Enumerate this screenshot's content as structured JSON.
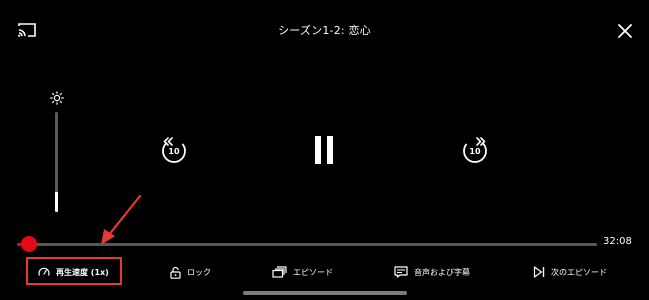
{
  "player": {
    "title": "シーズン1-2: 恋心",
    "current_time": "32:08",
    "progress_fraction": 0.02,
    "brightness_fraction": 0.2,
    "accent_color": "#e50914",
    "annotation_color": "#e53935"
  },
  "top_controls": {
    "cast_icon": "cast-icon",
    "close_icon": "close-icon"
  },
  "center_controls": {
    "skip_back_label": "10",
    "skip_forward_label": "10",
    "pause_icon": "pause-icon"
  },
  "bottom_bar": {
    "speed_label": "再生速度 (1x)",
    "lock_label": "ロック",
    "episodes_label": "エピソード",
    "subtitles_label": "音声および字幕",
    "next_episode_label": "次のエピソード"
  }
}
